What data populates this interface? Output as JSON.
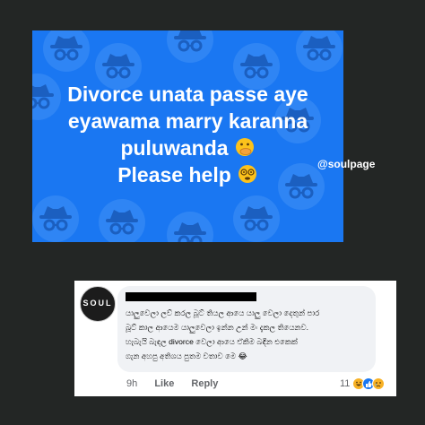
{
  "post": {
    "lines": [
      "Divorce unata passe aye",
      "eyawama marry karanna",
      "puluwanda",
      "Please help"
    ],
    "emoji_icons": [
      "hand-over-mouth-face-icon",
      "dizzy-eyes-face-icon"
    ],
    "background_icon": "incognito-hat-glasses-icon"
  },
  "watermark": "@soulpage",
  "comment": {
    "avatar_label": "SOUL",
    "lines": [
      "යාලුවෙලා ලව් කරල බූට් තියල ආයෙ යාලු වෙලා දෙතුන් පාර",
      "බූට් කාල ආයෙම යාලුවෙලා ඉන්න උන් මං දැකල තියෙනව.",
      "හැබැයි බැඳල divorce වෙලා ආයෙ ඒකිම බඳින එකෙක්",
      "ගැන අහපු අතිශය පුතම වතාව මෙ 😂"
    ],
    "time": "9h",
    "like_label": "Like",
    "reply_label": "Reply",
    "reaction_count": "11",
    "reaction_icons": [
      "haha-reaction-icon",
      "like-reaction-icon",
      "sad-reaction-icon"
    ]
  },
  "colors": {
    "page_bg": "#232625",
    "post_bg": "#1a77f2",
    "bubble_bg": "#f0f2f5",
    "meta_text": "#65676b"
  }
}
